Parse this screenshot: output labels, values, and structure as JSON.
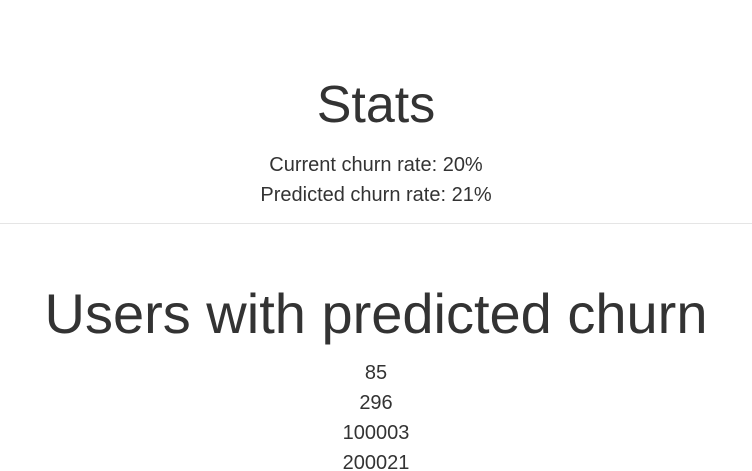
{
  "stats": {
    "title": "Stats",
    "current_churn_rate": "Current churn rate: 20%",
    "predicted_churn_rate": "Predicted churn rate: 21%"
  },
  "users": {
    "title": "Users with predicted churn",
    "ids": [
      "85",
      "296",
      "100003",
      "200021"
    ]
  },
  "colors": {
    "text": "#333333",
    "divider": "#e5e5e5",
    "background": "#ffffff"
  }
}
